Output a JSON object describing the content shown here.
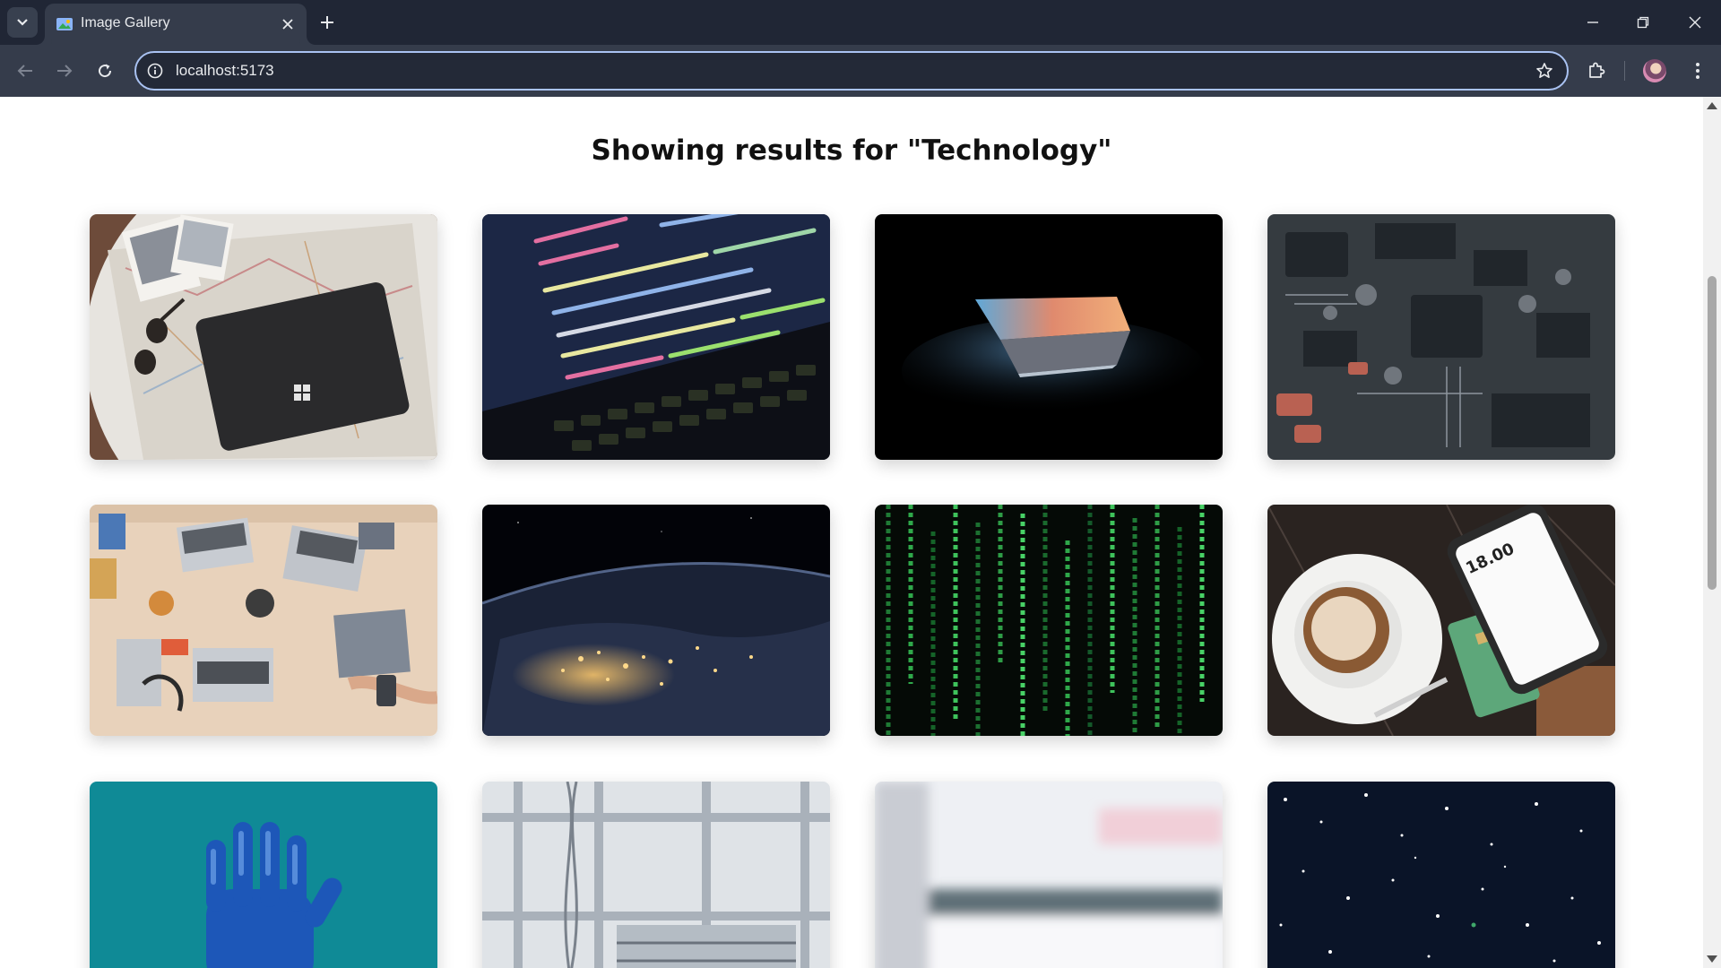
{
  "browser": {
    "tab_title": "Image Gallery",
    "url": "localhost:5173"
  },
  "page": {
    "heading": "Showing results for \"Technology\""
  }
}
